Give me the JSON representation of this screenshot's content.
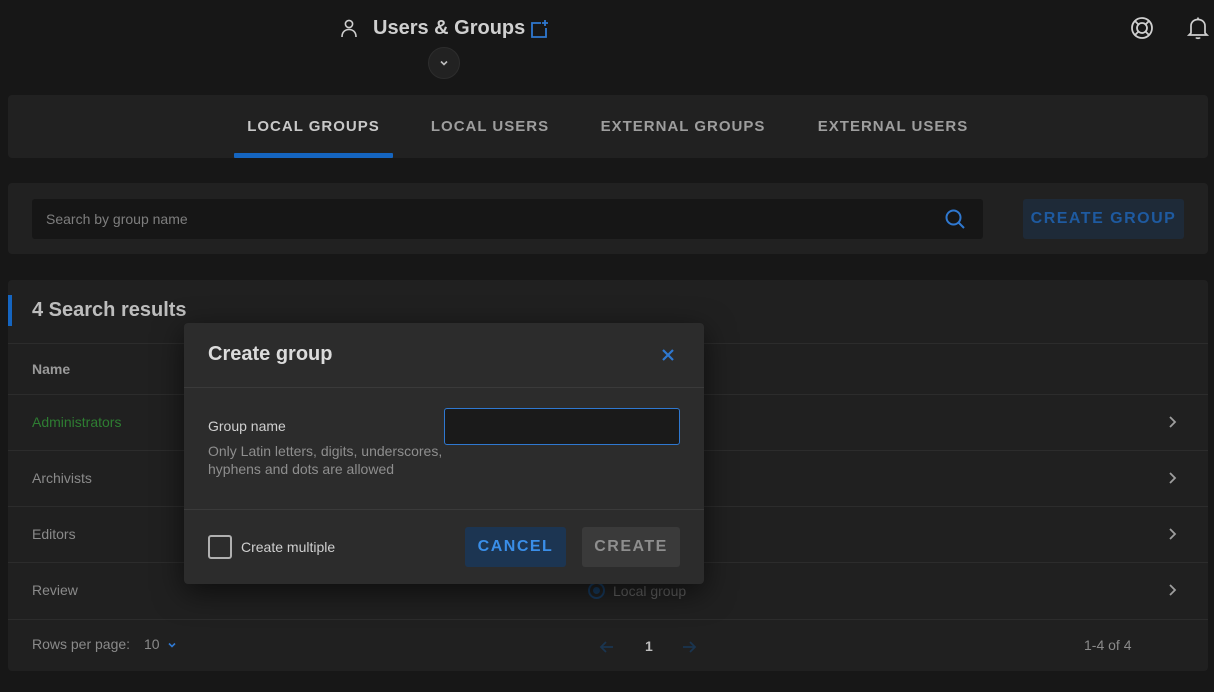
{
  "header": {
    "title": "Users & Groups",
    "icons": {
      "user": "person-icon",
      "add": "add-window-icon",
      "help": "lifebuoy-icon",
      "notifications": "bell-icon",
      "collapse": "chevron-down-icon"
    }
  },
  "tabs": [
    {
      "label": "LOCAL GROUPS",
      "active": true
    },
    {
      "label": "LOCAL USERS",
      "active": false
    },
    {
      "label": "EXTERNAL GROUPS",
      "active": false
    },
    {
      "label": "EXTERNAL USERS",
      "active": false
    }
  ],
  "search": {
    "placeholder": "Search by group name",
    "create_button": "CREATE GROUP"
  },
  "results": {
    "title": "4 Search results",
    "columns": {
      "name": "Name"
    },
    "rows": [
      {
        "name": "Administrators"
      },
      {
        "name": "Archivists"
      },
      {
        "name": "Editors"
      },
      {
        "name": "Review",
        "type": "Local group"
      }
    ]
  },
  "footer": {
    "rows_per_page_label": "Rows per page:",
    "rows_per_page_value": "10",
    "current_page": "1",
    "range": "1-4 of 4"
  },
  "modal": {
    "title": "Create group",
    "field_label": "Group name",
    "field_hint": "Only Latin letters, digits, underscores, hyphens and dots are allowed",
    "field_value": "",
    "checkbox_label": "Create multiple",
    "checkbox_checked": false,
    "cancel_label": "CANCEL",
    "create_label": "CREATE"
  },
  "colors": {
    "accent": "#1565c0",
    "background": "#171717",
    "panel": "#212121",
    "modal": "#2c2c2c",
    "link_green": "#2e7d32"
  }
}
